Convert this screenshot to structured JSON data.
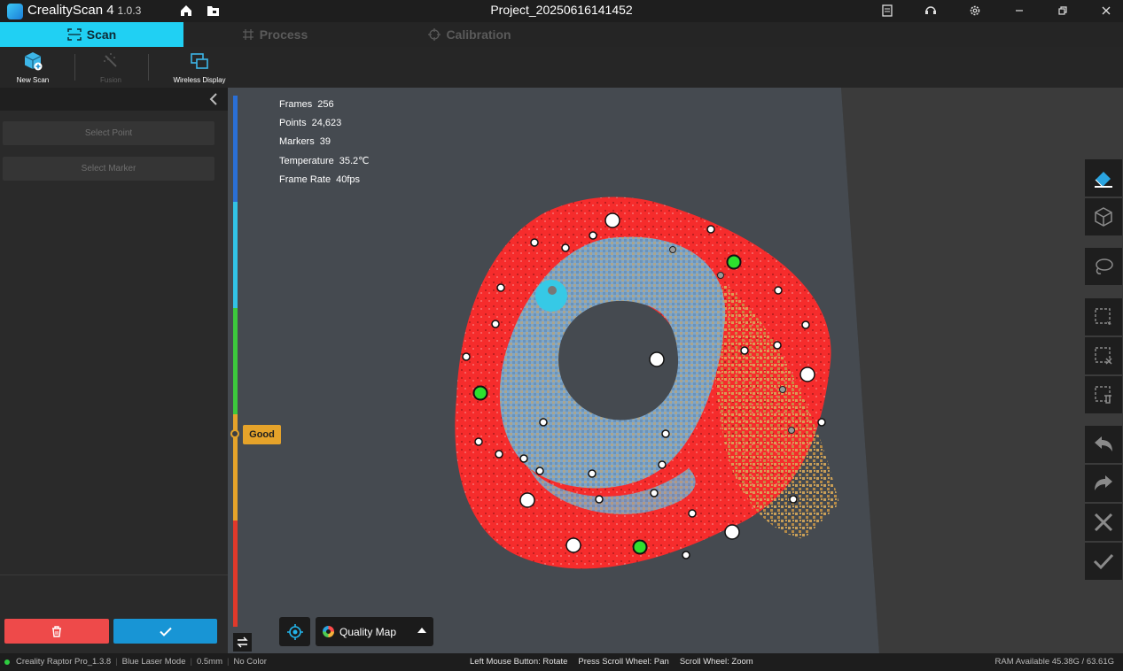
{
  "app": {
    "name": "CrealityScan 4",
    "version": "1.0.3",
    "project_title": "Project_20250616141452"
  },
  "tabs": [
    {
      "label": "Scan",
      "active": true
    },
    {
      "label": "Process",
      "active": false
    },
    {
      "label": "Calibration",
      "active": false
    }
  ],
  "toolbar": {
    "new_scan": "New Scan",
    "fusion": "Fusion",
    "wireless_display": "Wireless Display"
  },
  "left_panel": {
    "select_point": "Select Point",
    "select_marker": "Select Marker"
  },
  "stats": {
    "frames_label": "Frames",
    "frames_value": "256",
    "points_label": "Points",
    "points_value": "24,623",
    "markers_label": "Markers",
    "markers_value": "39",
    "temperature_label": "Temperature",
    "temperature_value": "35.2℃",
    "framerate_label": "Frame Rate",
    "framerate_value": "40fps"
  },
  "quality_indicator": {
    "label": "Good",
    "colors": [
      "#2a6fd6",
      "#32c3e6",
      "#3cc83c",
      "#e5a32a",
      "#e0392b"
    ]
  },
  "view_controls": {
    "quality_map": "Quality Map"
  },
  "status_bar": {
    "device": "Creality Raptor Pro_1.3.8",
    "mode": "Blue Laser Mode",
    "resolution": "0.5mm",
    "color": "No Color",
    "hint_rotate": "Left Mouse Button: Rotate",
    "hint_pan": "Press Scroll Wheel: Pan",
    "hint_zoom": "Scroll Wheel: Zoom",
    "ram": "RAM Available 45.38G / 63.61G"
  },
  "colors": {
    "accent": "#20d0f3",
    "delete": "#ee4a4a",
    "confirm": "#1895d5",
    "point_cloud_red": "#ff2a2a",
    "mesh_blue": "#6f9bc4",
    "mesh_gold": "#d7a85a"
  }
}
